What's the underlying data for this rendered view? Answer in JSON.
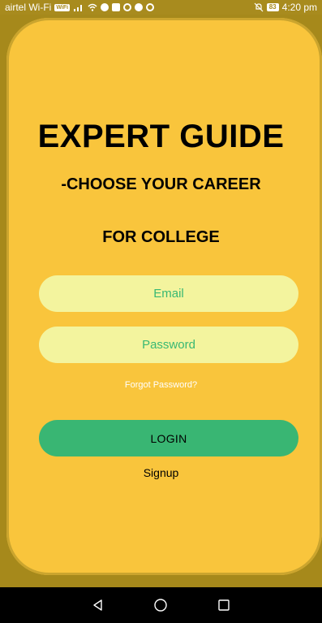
{
  "status_bar": {
    "carrier": "airtel Wi-Fi",
    "wifi_badge": "WiFi",
    "battery": "83",
    "time": "4:20 pm"
  },
  "login": {
    "title": "EXPERT GUIDE",
    "subtitle": "-CHOOSE YOUR CAREER",
    "subtitle2": "FOR COLLEGE",
    "email_placeholder": "Email",
    "password_placeholder": "Password",
    "forgot_label": "Forgot Password?",
    "login_label": "LOGIN",
    "signup_label": "Signup"
  },
  "colors": {
    "card_background": "#F9C53C",
    "field_background": "#F3F49E",
    "accent_green": "#39B673",
    "page_background": "#A6891B"
  },
  "nav": {
    "icons": [
      "back-icon",
      "home-icon",
      "recents-icon"
    ]
  }
}
